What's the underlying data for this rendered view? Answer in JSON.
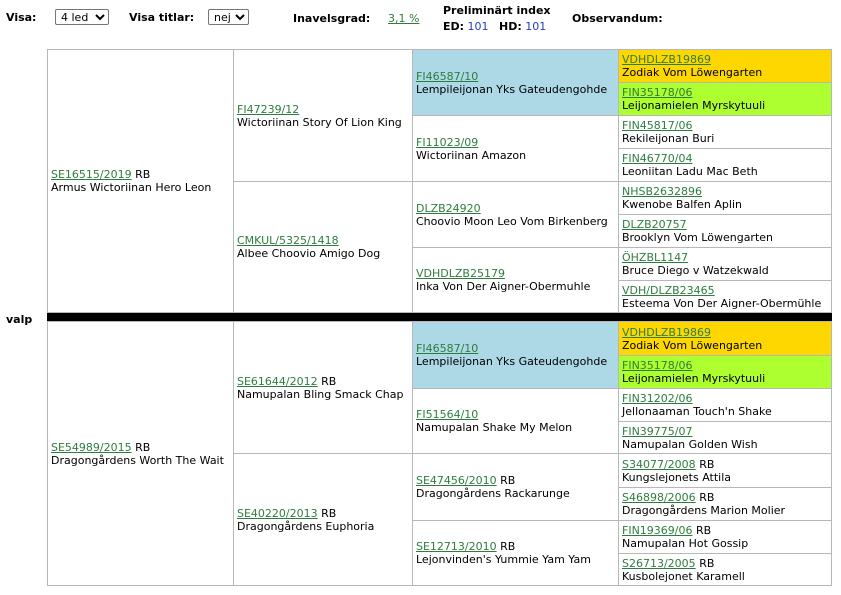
{
  "controls": {
    "visa_label": "Visa:",
    "visa_value": "4 led",
    "visa_titlar_label": "Visa titlar:",
    "visa_titlar_value": "nej",
    "inavel_label": "Inavelsgrad:",
    "inavel_value": "3,1 %",
    "prelim_label": "Preliminärt index",
    "ed_label": "ED:",
    "ed_value": "101",
    "hd_label": "HD:",
    "hd_value": "101",
    "observandum_label": "Observandum:"
  },
  "valp_label": "valp",
  "sire": {
    "reg": "SE16515/2019",
    "suffix": "RB",
    "name": "Armus Wictoriinan Hero Leon",
    "s": {
      "reg": "FI47239/12",
      "suffix": "",
      "name": "Wictoriinan Story Of Lion King",
      "s": {
        "reg": "FI46587/10",
        "name": "Lempileijonan Yks Gateudengohde",
        "s": {
          "reg": "VDHDLZB19869",
          "suffix": "",
          "name": "Zodiak Vom Löwengarten"
        },
        "d": {
          "reg": "FIN35178/06",
          "suffix": "",
          "name": "Leijonamielen Myrskytuuli"
        }
      },
      "d": {
        "reg": "FI11023/09",
        "name": "Wictoriinan Amazon",
        "s": {
          "reg": "FIN45817/06",
          "suffix": "",
          "name": "Rekileijonan Buri"
        },
        "d": {
          "reg": "FIN46770/04",
          "suffix": "",
          "name": "Leoniitan Ladu Mac Beth"
        }
      }
    },
    "d": {
      "reg": "CMKUL/5325/1418",
      "suffix": "",
      "name": "Albee Choovio Amigo Dog",
      "s": {
        "reg": "DLZB24920",
        "name": "Choovio Moon Leo Vom Birkenberg",
        "s": {
          "reg": "NHSB2632896",
          "suffix": "",
          "name": "Kwenobe Balfen Aplin"
        },
        "d": {
          "reg": "DLZB20757",
          "suffix": "",
          "name": "Brooklyn Vom Löwengarten"
        }
      },
      "d": {
        "reg": "VDHDLZB25179",
        "name": "Inka Von Der Aigner-Obermuhle",
        "s": {
          "reg": "ÖHZBL1147",
          "suffix": "",
          "name": "Bruce Diego v Watzekwald"
        },
        "d": {
          "reg": "VDH/DLZB23465",
          "suffix": "",
          "name": "Esteema Von Der Aigner-Obermühle"
        }
      }
    }
  },
  "dam": {
    "reg": "SE54989/2015",
    "suffix": "RB",
    "name": "Dragongårdens Worth The Wait",
    "s": {
      "reg": "SE61644/2012",
      "suffix": "RB",
      "name": "Namupalan Bling Smack Chap",
      "s": {
        "reg": "FI46587/10",
        "name": "Lempileijonan Yks Gateudengohde",
        "s": {
          "reg": "VDHDLZB19869",
          "suffix": "",
          "name": "Zodiak Vom Löwengarten"
        },
        "d": {
          "reg": "FIN35178/06",
          "suffix": "",
          "name": "Leijonamielen Myrskytuuli"
        }
      },
      "d": {
        "reg": "FI51564/10",
        "name": "Namupalan Shake My Melon",
        "s": {
          "reg": "FIN31202/06",
          "suffix": "",
          "name": "Jellonaaman Touch'n Shake"
        },
        "d": {
          "reg": "FIN39775/07",
          "suffix": "",
          "name": "Namupalan Golden Wish"
        }
      }
    },
    "d": {
      "reg": "SE40220/2013",
      "suffix": "RB",
      "name": "Dragongårdens Euphoria",
      "s": {
        "reg": "SE47456/2010",
        "suffix": "RB",
        "name": "Dragongårdens Rackarunge",
        "s": {
          "reg": "S34077/2008",
          "suffix": "RB",
          "name": "Kungslejonets Attila"
        },
        "d": {
          "reg": "S46898/2006",
          "suffix": "RB",
          "name": "Dragongårdens Marion Molier"
        }
      },
      "d": {
        "reg": "SE12713/2010",
        "suffix": "RB",
        "name": "Lejonvinden's Yummie Yam Yam",
        "s": {
          "reg": "FIN19369/06",
          "suffix": "RB",
          "name": "Namupalan Hot Gossip"
        },
        "d": {
          "reg": "S26713/2005",
          "suffix": "RB",
          "name": "Kusbolejonet Karamell"
        }
      }
    }
  },
  "colors": {
    "link": "#2e7d3e",
    "highlight_blue": "#add8e6",
    "highlight_gold": "#ffd700",
    "highlight_green": "#adff2f",
    "index_blue": "#1f3fbf"
  }
}
